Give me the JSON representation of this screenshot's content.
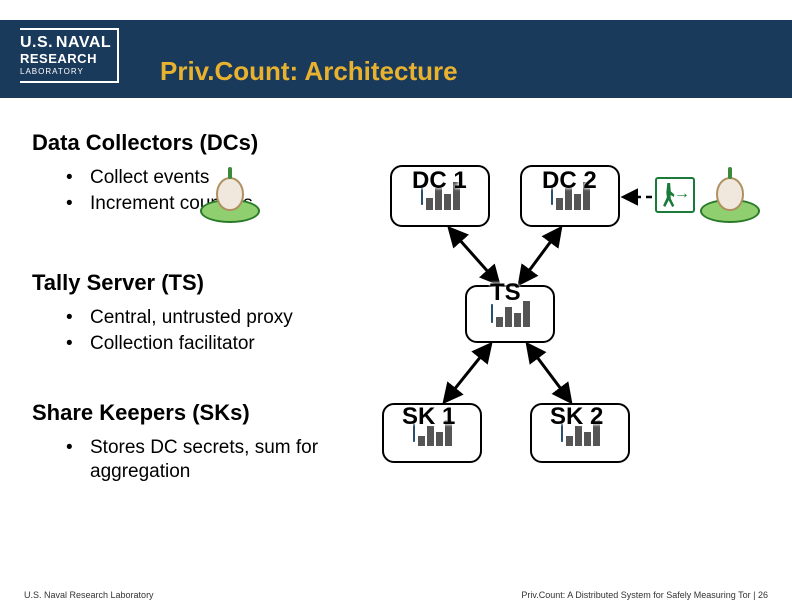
{
  "header": {
    "logo_line1": "U.S.",
    "logo_line2": "NAVAL",
    "logo_line3": "RESEARCH",
    "logo_line4": "LABORATORY",
    "title": "Priv.Count: Architecture"
  },
  "sections": {
    "dc": {
      "title": "Data Collectors (DCs)",
      "bullets": [
        "Collect events",
        "Increment counters"
      ]
    },
    "ts": {
      "title": "Tally Server (TS)",
      "bullets": [
        "Central, untrusted proxy",
        "Collection facilitator"
      ]
    },
    "sk": {
      "title": "Share Keepers (SKs)",
      "bullets": [
        "Stores DC secrets, sum for aggregation"
      ]
    }
  },
  "diagram": {
    "dc1": "DC 1",
    "dc2": "DC 2",
    "ts": "TS",
    "sk1": "SK 1",
    "sk2": "SK 2"
  },
  "footer": {
    "left": "U.S. Naval Research Laboratory",
    "right_text": "Priv.Count: A Distributed System for Safely Measuring Tor | ",
    "page": "26"
  }
}
